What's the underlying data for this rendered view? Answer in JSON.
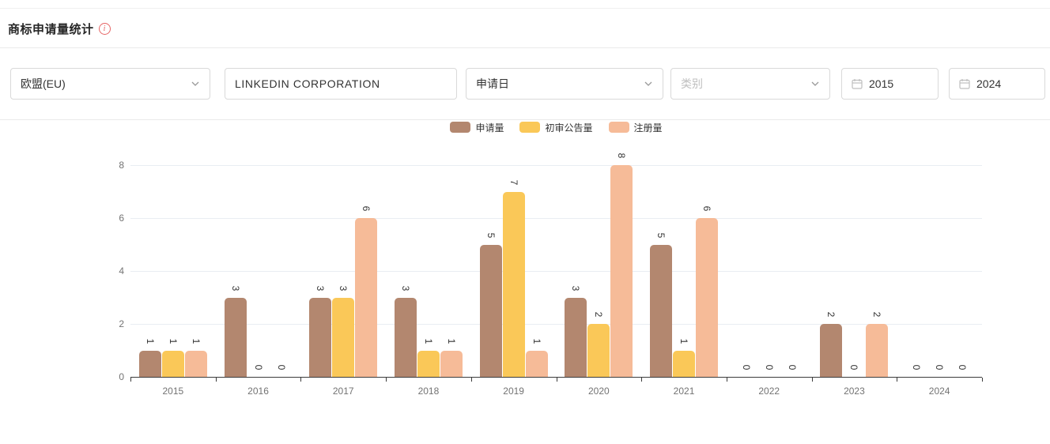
{
  "header": {
    "title": "商标申请量统计",
    "info_icon": "info-circle"
  },
  "filters": {
    "region": "欧盟(EU)",
    "applicant": "LINKEDIN CORPORATION",
    "date_type": "申请日",
    "category_placeholder": "类别",
    "year_from": "2015",
    "year_to": "2024"
  },
  "chart_data": {
    "type": "bar",
    "title": "商标申请量统计",
    "categories": [
      "2015",
      "2016",
      "2017",
      "2018",
      "2019",
      "2020",
      "2021",
      "2022",
      "2023",
      "2024"
    ],
    "series": [
      {
        "name": "申请量",
        "color": "#b3876f",
        "values": [
          1,
          3,
          3,
          3,
          5,
          3,
          5,
          0,
          2,
          0
        ]
      },
      {
        "name": "初审公告量",
        "color": "#fac858",
        "values": [
          1,
          0,
          3,
          1,
          7,
          2,
          1,
          0,
          0,
          0
        ]
      },
      {
        "name": "注册量",
        "color": "#f6bb98",
        "values": [
          1,
          0,
          6,
          1,
          1,
          8,
          6,
          0,
          2,
          0
        ]
      }
    ],
    "xlabel": "",
    "ylabel": "",
    "ylim": [
      0,
      8
    ],
    "yticks": [
      0,
      2,
      4,
      6,
      8
    ],
    "grid": true,
    "legend_position": "top-center",
    "value_labels": "rotated-90"
  },
  "colors": {
    "axis": "#3c3c3c",
    "gridline": "#e9edf2",
    "tick_label": "#737373",
    "accent_info": "#e66565"
  }
}
